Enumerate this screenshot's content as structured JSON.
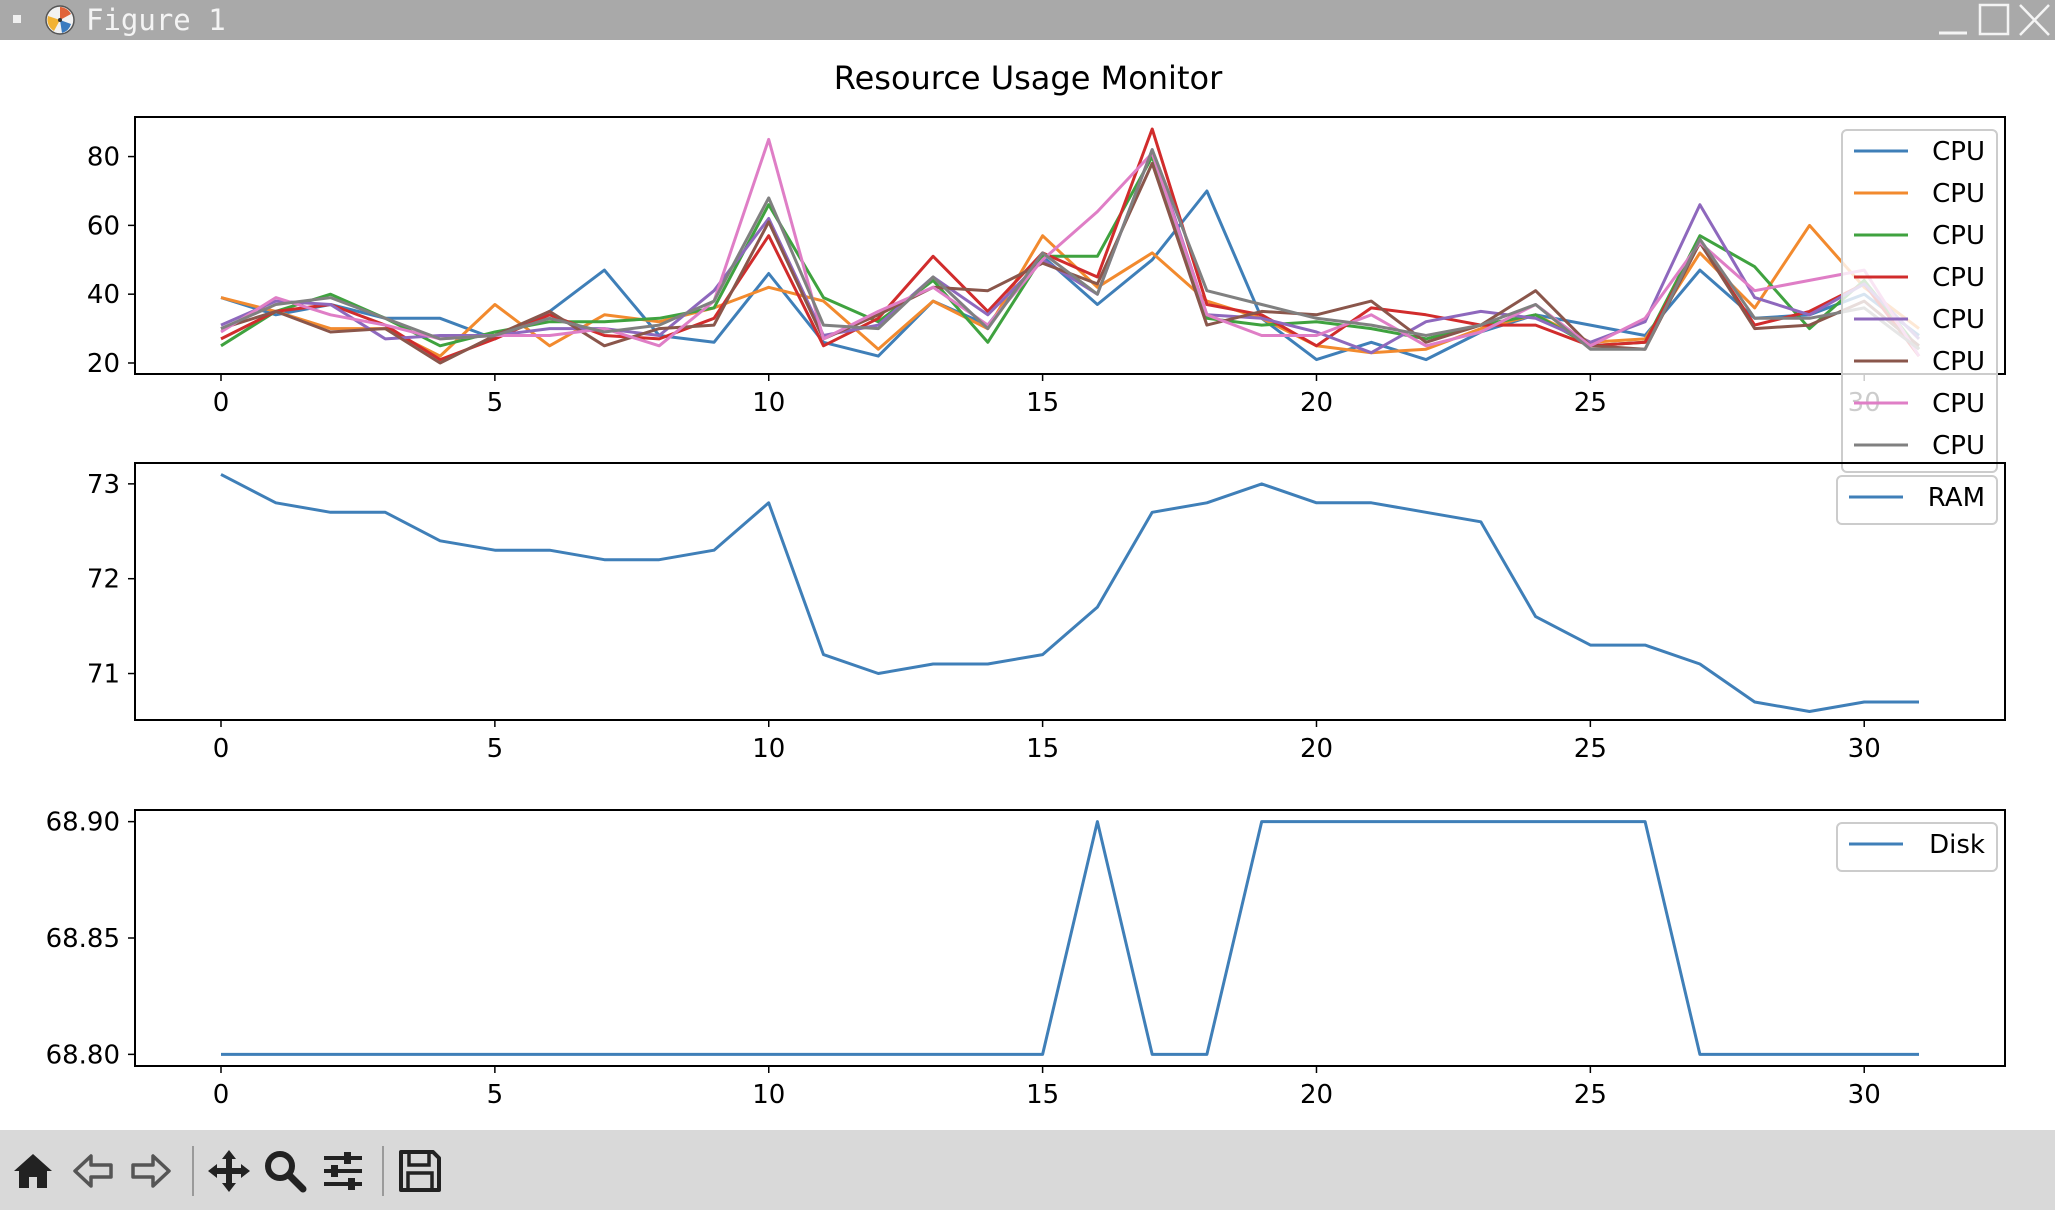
{
  "window": {
    "title": "Figure 1"
  },
  "toolbar": {
    "buttons": [
      "home-icon",
      "back-arrow-icon",
      "forward-arrow-icon",
      "pan-icon",
      "zoom-icon",
      "configure-subplots-icon",
      "save-icon"
    ]
  },
  "colors": {
    "titlebar": "#a9a9a9",
    "toolbar": "#d9d9d9",
    "series": [
      "#3f7fb8",
      "#f28a2e",
      "#3fa23f",
      "#d12c2c",
      "#8e68bd",
      "#8a564b",
      "#df7ec6",
      "#808080"
    ]
  },
  "chart_data": [
    {
      "type": "line",
      "title": "Resource Usage Monitor",
      "x": [
        0,
        1,
        2,
        3,
        4,
        5,
        6,
        7,
        8,
        9,
        10,
        11,
        12,
        13,
        14,
        15,
        16,
        17,
        18,
        19,
        20,
        21,
        22,
        23,
        24,
        25,
        26,
        27,
        28,
        29,
        30,
        31
      ],
      "xticks": [
        "0",
        "5",
        "10",
        "15",
        "20",
        "25",
        "30"
      ],
      "yticks": [
        "20",
        "40",
        "60",
        "80"
      ],
      "xlim": [
        -1.57,
        32.57
      ],
      "ylim": [
        16.8,
        91.5
      ],
      "legend": "upper right",
      "series": [
        {
          "name": "CPU",
          "values": [
            39,
            34,
            37,
            33,
            33,
            27,
            35,
            47,
            28,
            26,
            46,
            26,
            22,
            38,
            31,
            51,
            37,
            50,
            70,
            33,
            21,
            26,
            21,
            29,
            34,
            31,
            28,
            47,
            33,
            34,
            40,
            28
          ]
        },
        {
          "name": "CPU",
          "values": [
            39,
            35,
            30,
            30,
            22,
            37,
            25,
            34,
            32,
            36,
            42,
            38,
            24,
            38,
            30,
            57,
            42,
            52,
            38,
            33,
            25,
            23,
            24,
            30,
            34,
            26,
            27,
            52,
            36,
            60,
            42,
            30
          ]
        },
        {
          "name": "CPU",
          "values": [
            25,
            35,
            40,
            33,
            25,
            29,
            32,
            32,
            33,
            36,
            66,
            39,
            32,
            44,
            26,
            51,
            51,
            80,
            33,
            31,
            32,
            30,
            27,
            31,
            34,
            25,
            26,
            57,
            48,
            30,
            44,
            24
          ]
        },
        {
          "name": "CPU",
          "values": [
            27,
            35,
            37,
            31,
            21,
            27,
            34,
            28,
            27,
            33,
            57,
            25,
            33,
            51,
            35,
            52,
            45,
            88,
            37,
            34,
            25,
            36,
            34,
            31,
            31,
            25,
            26,
            55,
            31,
            35,
            43,
            22
          ]
        },
        {
          "name": "CPU",
          "values": [
            31,
            38,
            37,
            27,
            28,
            28,
            30,
            30,
            28,
            41,
            62,
            28,
            31,
            45,
            34,
            50,
            40,
            82,
            34,
            33,
            29,
            23,
            32,
            35,
            33,
            26,
            32,
            66,
            39,
            34,
            43,
            27
          ]
        },
        {
          "name": "CPU",
          "values": [
            30,
            35,
            29,
            30,
            20,
            28,
            35,
            25,
            30,
            31,
            61,
            27,
            34,
            42,
            41,
            49,
            43,
            78,
            31,
            35,
            34,
            38,
            26,
            31,
            41,
            25,
            24,
            55,
            30,
            31,
            38,
            25
          ]
        },
        {
          "name": "CPU",
          "values": [
            29,
            39,
            34,
            31,
            27,
            28,
            28,
            30,
            25,
            38,
            85,
            27,
            35,
            42,
            31,
            50,
            64,
            81,
            34,
            28,
            28,
            34,
            25,
            29,
            37,
            25,
            33,
            55,
            41,
            44,
            47,
            22
          ]
        },
        {
          "name": "CPU",
          "values": [
            30,
            37,
            39,
            33,
            27,
            28,
            33,
            29,
            31,
            38,
            68,
            31,
            30,
            45,
            30,
            52,
            40,
            82,
            41,
            37,
            33,
            31,
            28,
            31,
            37,
            24,
            24,
            56,
            33,
            33,
            36,
            24
          ]
        }
      ]
    },
    {
      "type": "line",
      "x": [
        0,
        1,
        2,
        3,
        4,
        5,
        6,
        7,
        8,
        9,
        10,
        11,
        12,
        13,
        14,
        15,
        16,
        17,
        18,
        19,
        20,
        21,
        22,
        23,
        24,
        25,
        26,
        27,
        28,
        29,
        30,
        31
      ],
      "xticks": [
        "0",
        "5",
        "10",
        "15",
        "20",
        "25",
        "30"
      ],
      "yticks": [
        "71",
        "72",
        "73"
      ],
      "xlim": [
        -1.57,
        32.57
      ],
      "ylim": [
        70.51,
        73.22
      ],
      "legend": "upper right",
      "series": [
        {
          "name": "RAM",
          "values": [
            73.1,
            72.8,
            72.7,
            72.7,
            72.4,
            72.3,
            72.3,
            72.2,
            72.2,
            72.3,
            72.8,
            71.2,
            71.0,
            71.1,
            71.1,
            71.2,
            71.7,
            72.7,
            72.8,
            73.0,
            72.8,
            72.8,
            72.7,
            72.6,
            71.6,
            71.3,
            71.3,
            71.1,
            70.7,
            70.6,
            70.7,
            70.7
          ]
        }
      ]
    },
    {
      "type": "line",
      "x": [
        0,
        1,
        2,
        3,
        4,
        5,
        6,
        7,
        8,
        9,
        10,
        11,
        12,
        13,
        14,
        15,
        16,
        17,
        18,
        19,
        20,
        21,
        22,
        23,
        24,
        25,
        26,
        27,
        28,
        29,
        30,
        31
      ],
      "xticks": [
        "0",
        "5",
        "10",
        "15",
        "20",
        "25",
        "30"
      ],
      "yticks": [
        "68.80",
        "68.85",
        "68.90"
      ],
      "xlim": [
        -1.57,
        32.57
      ],
      "ylim": [
        68.795,
        68.905
      ],
      "legend": "upper right",
      "series": [
        {
          "name": "Disk",
          "values": [
            68.8,
            68.8,
            68.8,
            68.8,
            68.8,
            68.8,
            68.8,
            68.8,
            68.8,
            68.8,
            68.8,
            68.8,
            68.8,
            68.8,
            68.8,
            68.8,
            68.9,
            68.8,
            68.8,
            68.9,
            68.9,
            68.9,
            68.9,
            68.9,
            68.9,
            68.9,
            68.9,
            68.8,
            68.8,
            68.8,
            68.8,
            68.8
          ]
        }
      ]
    }
  ]
}
